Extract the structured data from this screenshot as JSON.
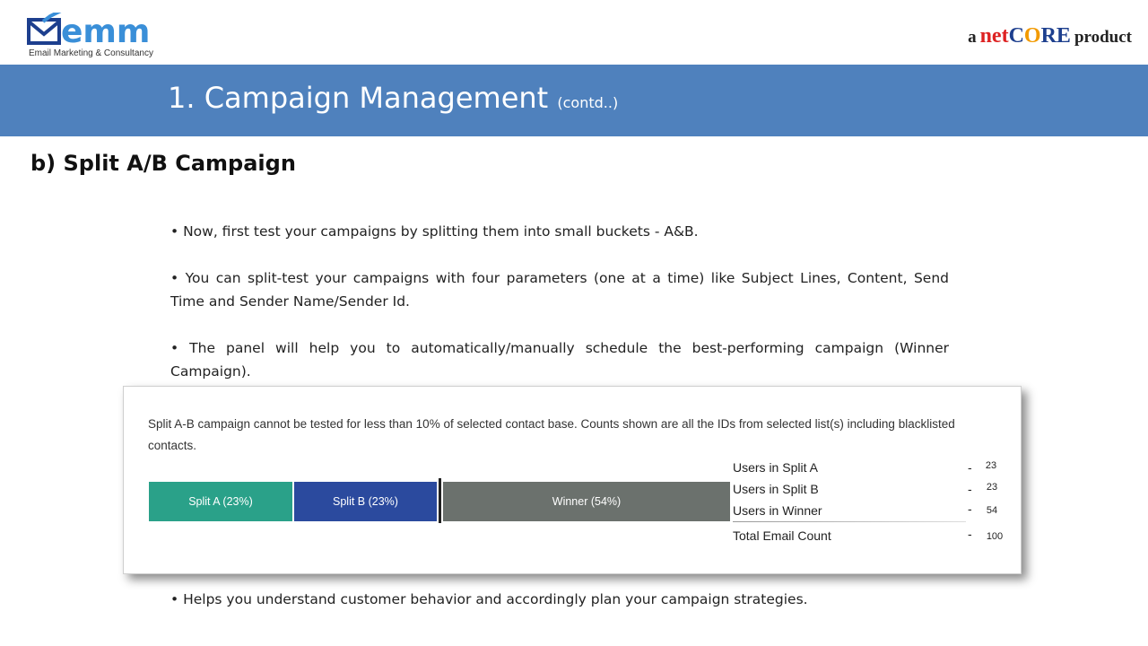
{
  "logo": {
    "name": "emm",
    "tagline": "Email Marketing & Consultancy"
  },
  "brand": {
    "prefix": "a",
    "net": "net",
    "core_c": "C",
    "core_o": "O",
    "core_re": "RE",
    "suffix": "product"
  },
  "title": {
    "main": "1. Campaign Management",
    "suffix": "(contd..)"
  },
  "subheading": "b) Split A/B Campaign",
  "bullets": [
    "• Now, first test  your campaigns by splitting them into small buckets - A&B.",
    "• You can split-test your campaigns with four parameters (one at a time) like  Subject Lines, Content, Send Time and Sender Name/Sender Id.",
    "• The panel will help you to automatically/manually schedule the best-performing  campaign (Winner Campaign).",
    "• Helps you understand customer behavior and accordingly plan your campaign strategies."
  ],
  "panel": {
    "note": "Split A-B campaign cannot be tested for less than 10% of selected contact base. Counts shown are all the IDs from selected list(s) including blacklisted contacts.",
    "segments": [
      {
        "label": "Split A (23%)",
        "percent": 23,
        "color": "#2aa189"
      },
      {
        "label": "Split B (23%)",
        "percent": 23,
        "color": "#2b4a9e"
      },
      {
        "label": "Winner (54%)",
        "percent": 54,
        "color": "#6b716d"
      }
    ],
    "stats": [
      {
        "label": "Users in Split A",
        "dash": "-",
        "value": "23"
      },
      {
        "label": "Users in Split B",
        "dash": "-",
        "value": "23"
      },
      {
        "label": "Users in Winner",
        "dash": "-",
        "value": "54"
      },
      {
        "label": "Total Email Count",
        "dash": "-",
        "value": "100"
      }
    ]
  },
  "colors": {
    "band": "#4f81bd",
    "logo_blue": "#3a8fd8",
    "net_red": "#dd2222",
    "core_navy": "#1d3f8e",
    "core_orange": "#f29a00"
  }
}
